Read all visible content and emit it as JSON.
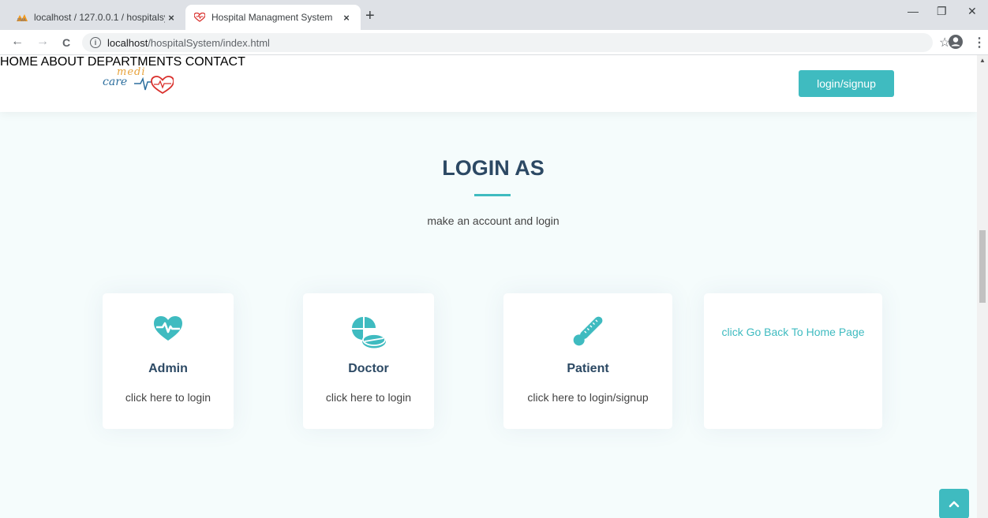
{
  "browser": {
    "tabs": [
      {
        "title": "localhost / 127.0.0.1 / hospitalsys",
        "close": "×"
      },
      {
        "title": "Hospital Managment System",
        "close": "×"
      }
    ],
    "new_tab": "+",
    "window_controls": {
      "minimize": "—",
      "restore": "❐",
      "close": "✕"
    },
    "nav": {
      "back": "←",
      "forward": "→",
      "reload": "C"
    },
    "url": {
      "host": "localhost",
      "path": "/hospitalSystem/index.html"
    },
    "right_icons": {
      "star": "☆",
      "menu": "⋮"
    }
  },
  "site": {
    "logo": {
      "top": "medi",
      "bottom": "care"
    },
    "nav": {
      "home": "HOME",
      "about": "ABOUT",
      "departments": "DEPARTMENTS",
      "contact": "CONTACT"
    },
    "login_button": "login/signup",
    "accent_color": "#3fbbc0"
  },
  "section": {
    "title": "LOGIN AS",
    "subtitle": "make an account and login"
  },
  "cards": [
    {
      "icon": "heartbeat-icon",
      "name": "Admin",
      "desc": "click here to login"
    },
    {
      "icon": "pills-icon",
      "name": "Doctor",
      "desc": "click here to login"
    },
    {
      "icon": "thermometer-icon",
      "name": "Patient",
      "desc": "click here to login/signup"
    },
    {
      "link": "click Go Back To Home Page"
    }
  ],
  "back_to_top_icon": "chevron-up-icon"
}
